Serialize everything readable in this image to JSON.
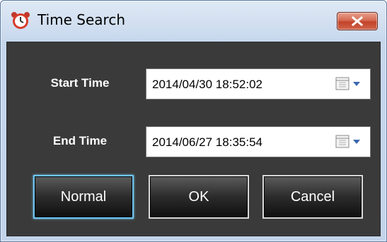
{
  "window": {
    "title": "Time Search",
    "close_icon": "close-icon",
    "app_icon": "alarm-clock-icon"
  },
  "form": {
    "start": {
      "label": "Start Time",
      "value": "2014/04/30 18:52:02",
      "picker_icon": "calendar-dropdown-icon"
    },
    "end": {
      "label": "End Time",
      "value": "2014/06/27 18:35:54",
      "picker_icon": "calendar-dropdown-icon"
    }
  },
  "buttons": {
    "normal": "Normal",
    "ok": "OK",
    "cancel": "Cancel"
  },
  "colors": {
    "client_background": "#3a3a3a",
    "focus_ring": "#6fc6f2",
    "close_button": "#c2432a"
  }
}
